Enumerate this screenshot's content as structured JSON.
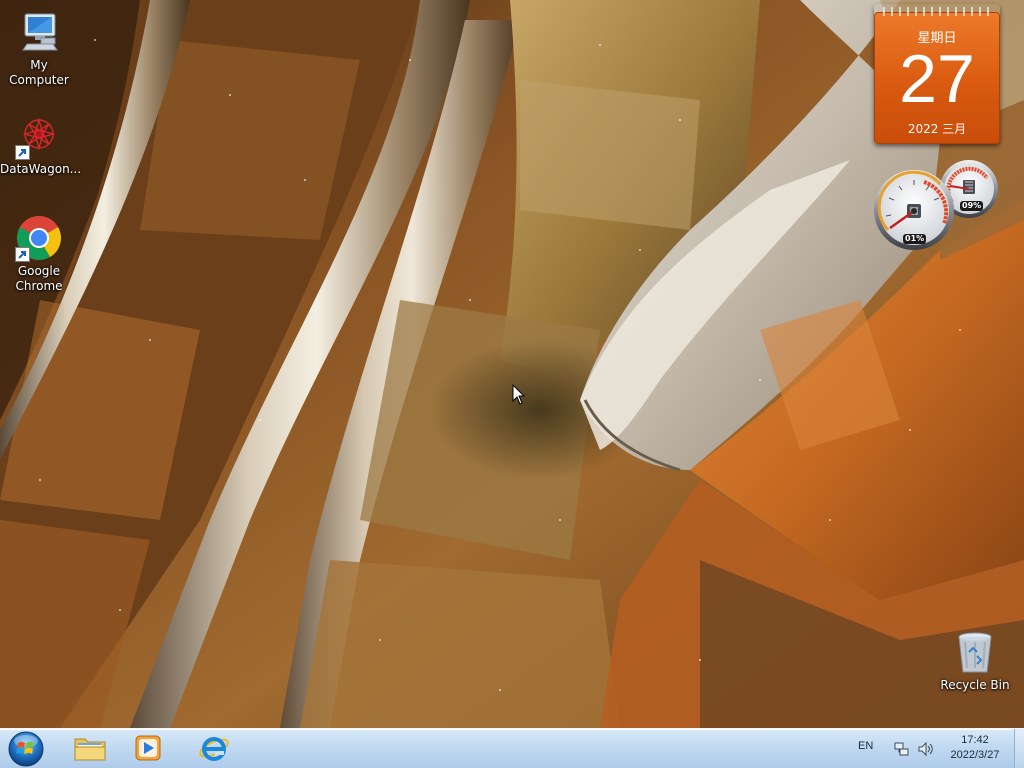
{
  "desktop": {
    "icons": [
      {
        "label": "My Computer",
        "icon": "computer-icon"
      },
      {
        "label": "DataWagon...",
        "icon": "datawagon-icon",
        "shortcut": true
      },
      {
        "label": "Google Chrome",
        "icon": "chrome-icon",
        "shortcut": true
      },
      {
        "label": "Recycle Bin",
        "icon": "recycle-bin-icon"
      }
    ]
  },
  "gadgets": {
    "calendar": {
      "weekday": "星期日",
      "day": "27",
      "year_month": "2022 三月"
    },
    "cpu_meter": {
      "cpu_percent": "01%",
      "memory_percent": "09%",
      "cpu_value": 0.01,
      "memory_value": 0.09
    }
  },
  "taskbar": {
    "start": {
      "icon": "windows-start-orb-icon"
    },
    "pinned": [
      {
        "name": "File Explorer",
        "icon": "folder-icon"
      },
      {
        "name": "Windows Media Player",
        "icon": "media-player-icon"
      },
      {
        "name": "Internet Explorer",
        "icon": "internet-explorer-icon"
      }
    ],
    "tray": {
      "language": "EN",
      "network_icon": "network-icon",
      "volume_icon": "speaker-icon",
      "time": "17:42",
      "date": "2022/3/27"
    }
  },
  "colors": {
    "calendar_orange": "#d95a10",
    "taskbar": "#c2daf1",
    "ie_blue": "#1e88d8"
  }
}
